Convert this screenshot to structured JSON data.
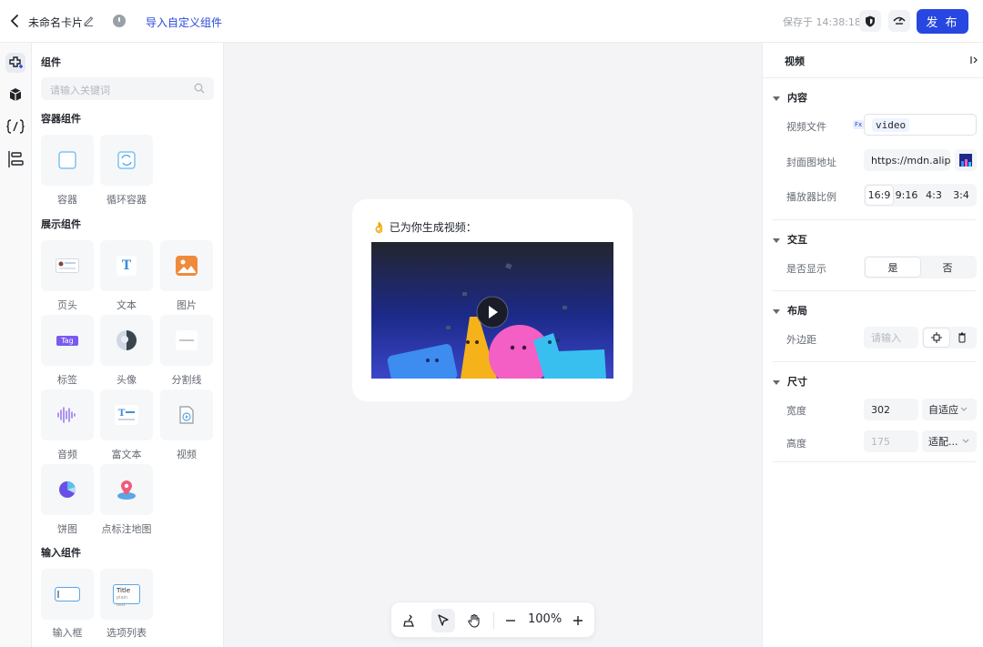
{
  "header": {
    "title": "未命名卡片",
    "import_label": "导入自定义组件",
    "saved_text": "保存于 14:38:18",
    "publish_label": "发 布"
  },
  "components": {
    "title": "组件",
    "search_placeholder": "请输入关键词",
    "groups": [
      {
        "title": "容器组件",
        "items": [
          {
            "label": "容器",
            "icon": "container-icon"
          },
          {
            "label": "循环容器",
            "icon": "loop-container-icon"
          }
        ]
      },
      {
        "title": "展示组件",
        "items": [
          {
            "label": "页头",
            "icon": "header-icon"
          },
          {
            "label": "文本",
            "icon": "text-icon"
          },
          {
            "label": "图片",
            "icon": "image-icon"
          },
          {
            "label": "标签",
            "icon": "tag-icon"
          },
          {
            "label": "头像",
            "icon": "avatar-icon"
          },
          {
            "label": "分割线",
            "icon": "divider-icon"
          },
          {
            "label": "音频",
            "icon": "audio-icon"
          },
          {
            "label": "富文本",
            "icon": "rich-text-icon"
          },
          {
            "label": "视频",
            "icon": "video-icon"
          },
          {
            "label": "饼图",
            "icon": "pie-chart-icon"
          },
          {
            "label": "点标注地图",
            "icon": "map-pin-icon"
          }
        ]
      },
      {
        "title": "输入组件",
        "items": [
          {
            "label": "输入框",
            "icon": "input-box-icon"
          },
          {
            "label": "选项列表",
            "icon": "option-list-icon"
          }
        ]
      }
    ],
    "tag_text": "Tag",
    "text_glyph": "T",
    "option_list_text": "Title",
    "option_list_sub": "plain text"
  },
  "canvas": {
    "message": "👌 已为你生成视频：",
    "zoom": "100%"
  },
  "props": {
    "title": "视频",
    "sections": {
      "content": "内容",
      "interaction": "交互",
      "layout": "布局",
      "size": "尺寸"
    },
    "video_file_label": "视频文件",
    "fx_label": "Fx",
    "video_file_value": "video",
    "cover_label": "封面图地址",
    "cover_value": "https://mdn.alipa",
    "ratio_label": "播放器比例",
    "ratios": [
      "16:9",
      "9:16",
      "4:3",
      "3:4"
    ],
    "ratio_selected": "16:9",
    "visible_label": "是否显示",
    "visible_options": [
      "是",
      "否"
    ],
    "visible_selected": "是",
    "margin_label": "外边距",
    "margin_placeholder": "请输入",
    "width_label": "宽度",
    "width_value": "302",
    "width_mode": "自适应",
    "height_label": "高度",
    "height_value": "175",
    "height_mode": "适配..."
  },
  "colors": {
    "accent": "#2747e0",
    "link": "#2a48d8"
  }
}
